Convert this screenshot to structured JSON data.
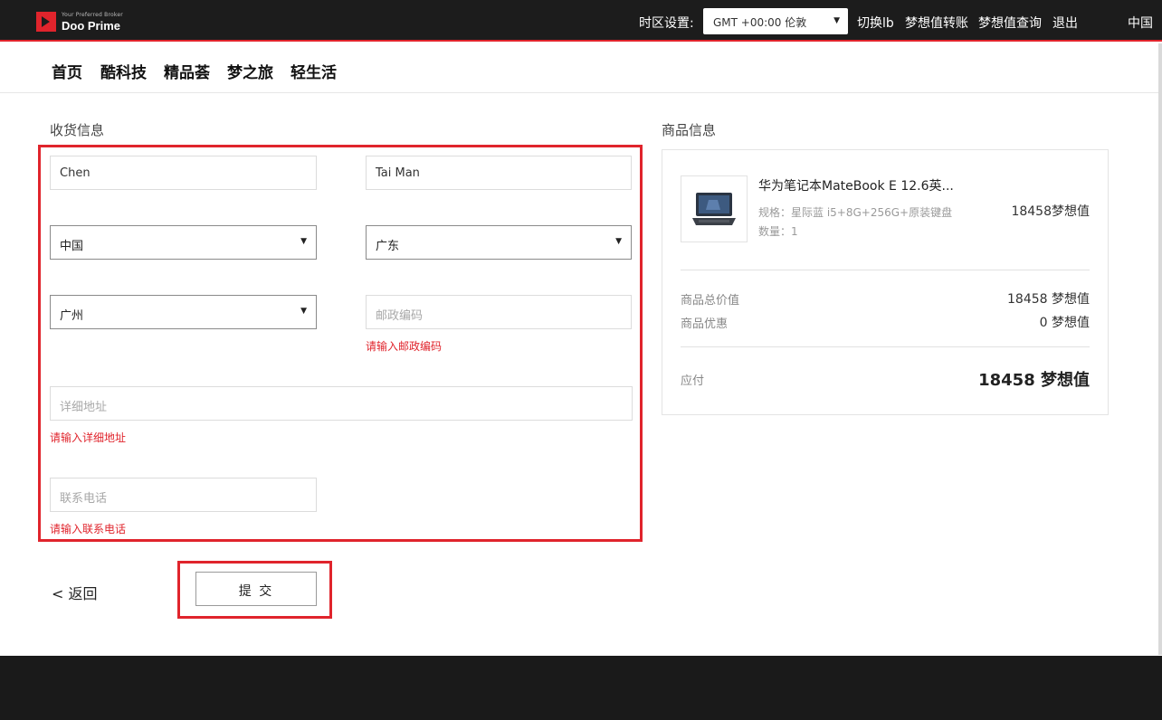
{
  "header": {
    "logo_tagline": "Your Preferred Broker",
    "logo_name": "Doo Prime",
    "timezone_label": "时区设置:",
    "timezone_value": "GMT +00:00 伦敦",
    "links": [
      "切换lb",
      "梦想值转账",
      "梦想值查询",
      "退出"
    ],
    "language": "中国"
  },
  "mainnav": [
    "首页",
    "酷科技",
    "精品荟",
    "梦之旅",
    "轻生活"
  ],
  "shipping": {
    "title": "收货信息",
    "first_name": "Chen",
    "last_name": "Tai Man",
    "country": "中国",
    "province": "广东",
    "city": "广州",
    "postcode_placeholder": "邮政编码",
    "postcode_error": "请输入邮政编码",
    "address_placeholder": "详细地址",
    "address_error": "请输入详细地址",
    "phone_placeholder": "联系电话",
    "phone_error": "请输入联系电话"
  },
  "actions": {
    "back_label": "< 返回",
    "submit_label": "提 交"
  },
  "product": {
    "title": "商品信息",
    "name": "华为笔记本MateBook E 12.6英...",
    "spec": "规格：星际蓝 i5+8G+256G+原装键盘",
    "qty": "数量：1",
    "price": "18458梦想值",
    "subtotal_label": "商品总价值",
    "subtotal_value": "18458 梦想值",
    "discount_label": "商品优惠",
    "discount_value": "0 梦想值",
    "total_label": "应付",
    "total_value": "18458 梦想值"
  },
  "colors": {
    "accent": "#e0242c",
    "topbar": "#1c1c1c",
    "footer": "#1a1a1a"
  }
}
